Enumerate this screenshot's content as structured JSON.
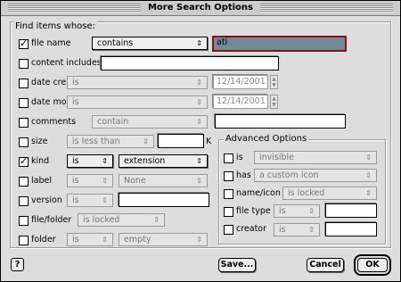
{
  "window": {
    "title": "More Search Options"
  },
  "main": {
    "group_label": "Find items whose:",
    "rows": {
      "file_name": {
        "label": "file name",
        "operator": "contains",
        "value": "ati"
      },
      "content_includes": {
        "label": "content includes",
        "value": ""
      },
      "date_created": {
        "label": "date created",
        "operator": "is",
        "value": "12/14/2001"
      },
      "date_modified": {
        "label": "date modified",
        "operator": "is",
        "value": "12/14/2001"
      },
      "comments": {
        "label": "comments",
        "operator": "contain",
        "value": ""
      },
      "size": {
        "label": "size",
        "operator": "is less than",
        "value": "",
        "unit": "K"
      },
      "kind": {
        "label": "kind",
        "operator": "is",
        "value": "extension"
      },
      "label": {
        "label": "label",
        "operator": "is",
        "value": "None"
      },
      "version": {
        "label": "version",
        "operator": "is",
        "value": ""
      },
      "file_folder": {
        "label": "file/folder",
        "operator": "is locked"
      },
      "folder": {
        "label": "folder",
        "operator": "is",
        "value": "empty"
      }
    }
  },
  "advanced": {
    "group_label": "Advanced Options",
    "rows": {
      "is": {
        "label": "is",
        "value": "invisible"
      },
      "has": {
        "label": "has",
        "value": "a custom icon"
      },
      "name_icon": {
        "label": "name/icon",
        "value": "is locked"
      },
      "file_type": {
        "label": "file type",
        "operator": "is",
        "value": ""
      },
      "creator": {
        "label": "creator",
        "operator": "is",
        "value": ""
      }
    }
  },
  "footer": {
    "help": "?",
    "save": "Save...",
    "cancel": "Cancel",
    "ok": "OK"
  },
  "colors": {
    "focus_field": "#6f8b97",
    "focus_ring": "#8b1010",
    "background": "#dddddd"
  }
}
